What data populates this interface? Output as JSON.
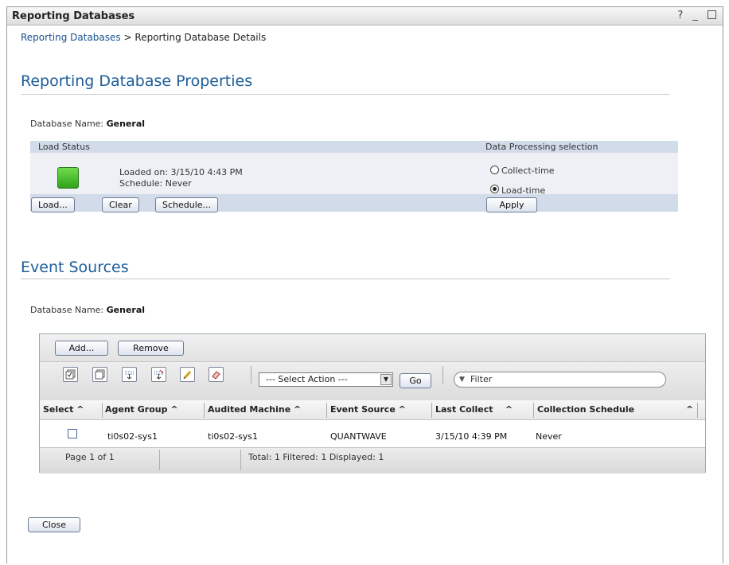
{
  "window": {
    "title": "Reporting Databases",
    "help": "?",
    "minimize": "_"
  },
  "breadcrumb": {
    "link": "Reporting Databases",
    "separator": ">",
    "current": "Reporting Database Details"
  },
  "properties": {
    "heading": "Reporting Database Properties",
    "db_label": "Database Name:",
    "db_name": "General",
    "load_status_header": "Load Status",
    "status_color": "#3cba28",
    "loaded_on": "Loaded on: 3/15/10 4:43 PM",
    "schedule": "Schedule: Never",
    "buttons": {
      "load": "Load...",
      "clear": "Clear",
      "schedule": "Schedule..."
    },
    "processing_header": "Data Processing selection",
    "options": [
      {
        "label": "Collect-time",
        "selected": false
      },
      {
        "label": "Load-time",
        "selected": true
      }
    ],
    "apply": "Apply"
  },
  "event_sources": {
    "heading": "Event Sources",
    "db_label": "Database Name:",
    "db_name": "General",
    "add": "Add...",
    "remove": "Remove",
    "select_action": "--- Select Action ---",
    "go": "Go",
    "filter_placeholder": "Filter",
    "columns": [
      "Select",
      "Agent Group",
      "Audited Machine",
      "Event Source",
      "Last Collect",
      "Collection Schedule"
    ],
    "sort_glyph": "^",
    "rows": [
      {
        "selected": false,
        "agent_group": "ti0s02-sys1",
        "audited_machine": "ti0s02-sys1",
        "event_source": "QUANTWAVE",
        "last_collect": "3/15/10 4:39 PM",
        "collection_schedule": "Never"
      }
    ],
    "page": "Page 1 of 1",
    "totals": "Total: 1   Filtered: 1   Displayed: 1"
  },
  "close": "Close"
}
